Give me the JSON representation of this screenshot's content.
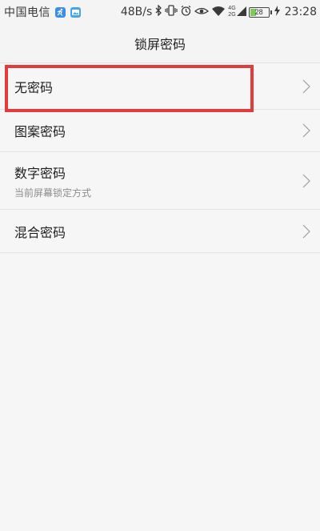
{
  "status_bar": {
    "carrier": "中国电信",
    "net_speed": "48B/s",
    "network_top": "4G",
    "network_bottom": "2G",
    "battery_level": "28",
    "time": "23:28"
  },
  "header": {
    "title": "锁屏密码"
  },
  "options": [
    {
      "label": "无密码",
      "subtitle": ""
    },
    {
      "label": "图案密码",
      "subtitle": ""
    },
    {
      "label": "数字密码",
      "subtitle": "当前屏幕锁定方式"
    },
    {
      "label": "混合密码",
      "subtitle": ""
    }
  ],
  "colors": {
    "highlight": "#e23b3b",
    "battery": "#7ccc5a"
  }
}
